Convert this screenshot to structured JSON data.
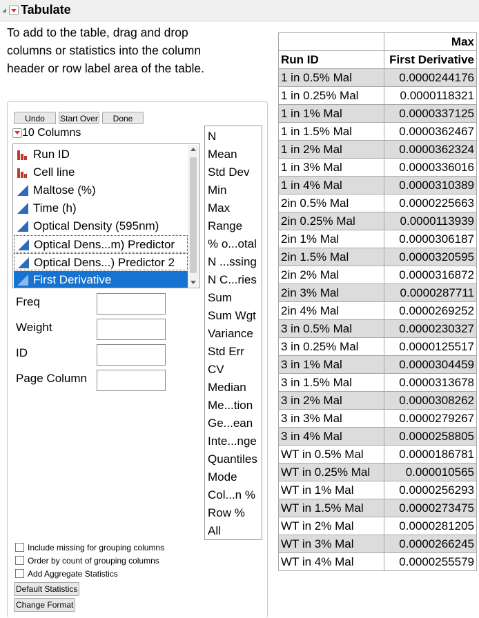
{
  "window": {
    "title": "Tabulate"
  },
  "instructions": "To add to the table, drag and drop columns or statistics into the column header or row label area of the table.",
  "buttons": {
    "undo": "Undo",
    "start_over": "Start Over",
    "done": "Done",
    "default_statistics": "Default Statistics",
    "change_format": "Change Format"
  },
  "columns": {
    "header": "10 Columns",
    "items": [
      {
        "label": "Run ID",
        "icon": "nominal-bar-icon"
      },
      {
        "label": "Cell line",
        "icon": "nominal-bar-icon"
      },
      {
        "label": "Maltose (%)",
        "icon": "continuous-triangle-icon"
      },
      {
        "label": "Time (h)",
        "icon": "continuous-triangle-icon"
      },
      {
        "label": "Optical Density (595nm)",
        "icon": "continuous-triangle-icon"
      },
      {
        "label": "Optical Dens...m) Predictor",
        "icon": "continuous-triangle-icon"
      },
      {
        "label": "Optical Dens...) Predictor 2",
        "icon": "continuous-triangle-icon"
      },
      {
        "label": "First Derivative",
        "icon": "continuous-triangle-icon",
        "selected": true
      }
    ]
  },
  "roles": {
    "freq": "Freq",
    "weight": "Weight",
    "id": "ID",
    "page_column": "Page Column"
  },
  "statistics": [
    "N",
    "Mean",
    "Std Dev",
    "Min",
    "Max",
    "Range",
    "% o...otal",
    "N ...ssing",
    "N C...ries",
    "Sum",
    "Sum Wgt",
    "Variance",
    "Std Err",
    "CV",
    "Median",
    "Me...tion",
    "Ge...ean",
    "Inte...nge",
    "Quantiles",
    "Mode",
    "Col...n %",
    "Row %",
    "All"
  ],
  "options": {
    "include_missing": "Include missing for grouping columns",
    "order_by_count": "Order by count of grouping columns",
    "add_aggregate": "Add Aggregate Statistics"
  },
  "table": {
    "stat_header": "Max",
    "row_header": "Run ID",
    "col_header": "First Derivative",
    "rows": [
      [
        "1 in 0.5% Mal",
        "0.0000244176"
      ],
      [
        "1 in 0.25% Mal",
        "0.0000118321"
      ],
      [
        "1 in 1% Mal",
        "0.0000337125"
      ],
      [
        "1 in 1.5% Mal",
        "0.0000362467"
      ],
      [
        "1 in 2% Mal",
        "0.0000362324"
      ],
      [
        "1 in 3% Mal",
        "0.0000336016"
      ],
      [
        "1 in 4% Mal",
        "0.0000310389"
      ],
      [
        "2in 0.5% Mal",
        "0.0000225663"
      ],
      [
        "2in 0.25% Mal",
        "0.0000113939"
      ],
      [
        "2in 1% Mal",
        "0.0000306187"
      ],
      [
        "2in 1.5% Mal",
        "0.0000320595"
      ],
      [
        "2in 2% Mal",
        "0.0000316872"
      ],
      [
        "2in 3% Mal",
        "0.0000287711"
      ],
      [
        "2in 4% Mal",
        "0.0000269252"
      ],
      [
        "3 in 0.5% Mal",
        "0.0000230327"
      ],
      [
        "3 in 0.25% Mal",
        "0.0000125517"
      ],
      [
        "3 in 1% Mal",
        "0.0000304459"
      ],
      [
        "3 in 1.5% Mal",
        "0.0000313678"
      ],
      [
        "3 in 2% Mal",
        "0.0000308262"
      ],
      [
        "3 in 3% Mal",
        "0.0000279267"
      ],
      [
        "3 in 4% Mal",
        "0.0000258805"
      ],
      [
        "WT in 0.5% Mal",
        "0.0000186781"
      ],
      [
        "WT in 0.25% Mal",
        "0.000010565"
      ],
      [
        "WT in 1% Mal",
        "0.0000256293"
      ],
      [
        "WT in 1.5% Mal",
        "0.0000273475"
      ],
      [
        "WT in 2% Mal",
        "0.0000281205"
      ],
      [
        "WT in 3% Mal",
        "0.0000266245"
      ],
      [
        "WT in 4% Mal",
        "0.0000255579"
      ]
    ]
  },
  "colors": {
    "selection": "#1673d1",
    "nominal_icon": "#c0392b",
    "continuous_icon": "#2e6bb8",
    "alt_row": "#dcdcdc"
  }
}
